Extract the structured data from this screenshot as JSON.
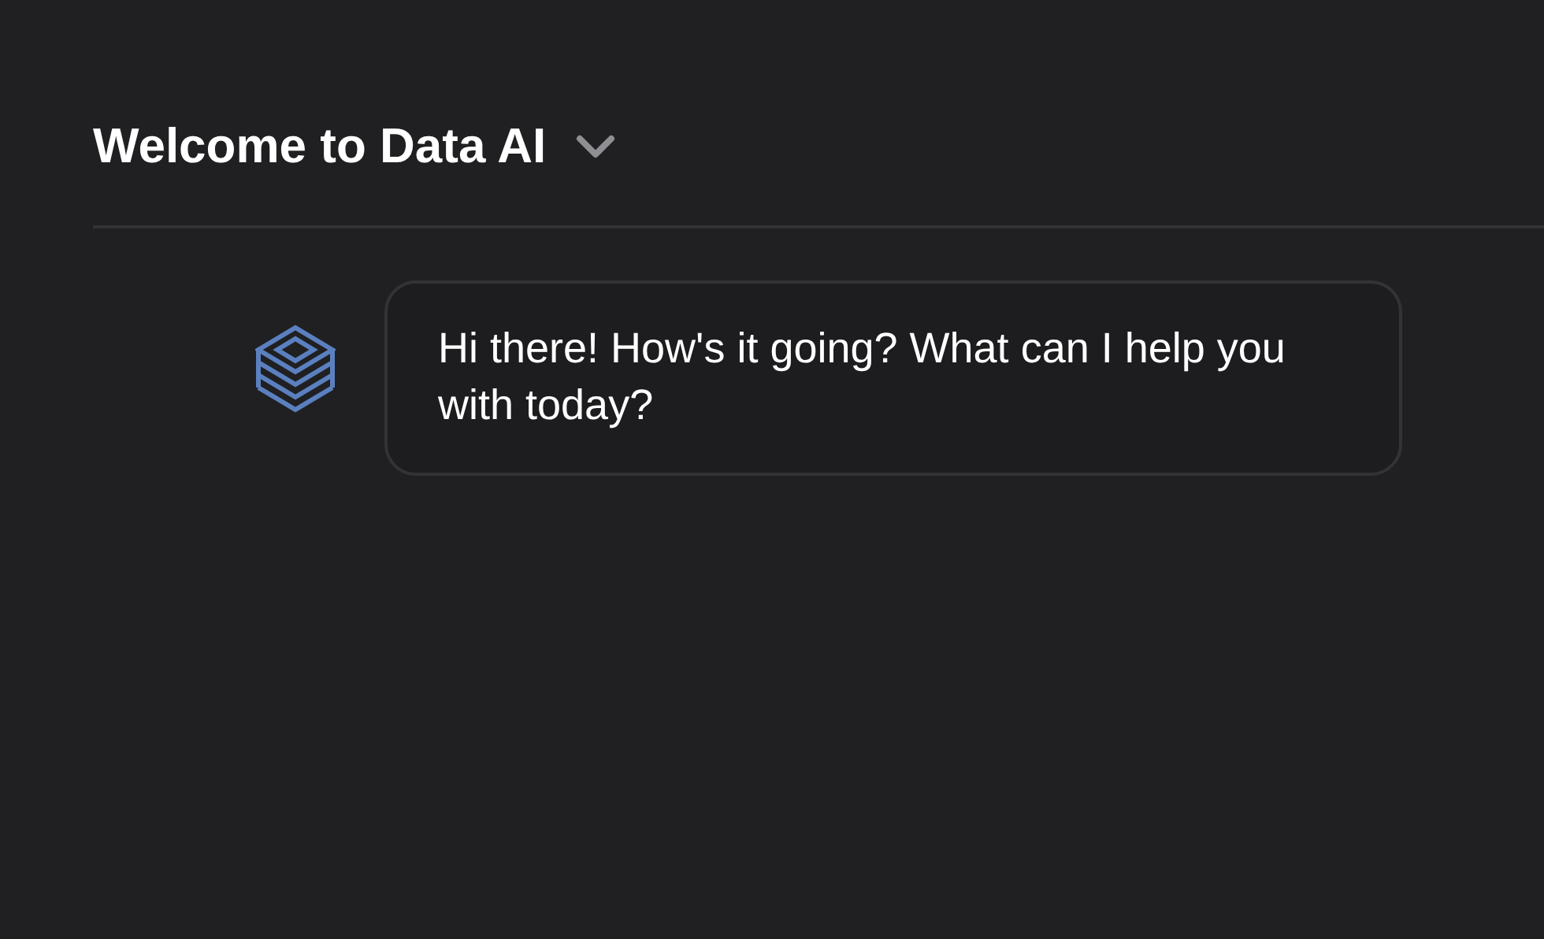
{
  "header": {
    "title": "Welcome to Data AI"
  },
  "messages": [
    {
      "kind": "assistant",
      "text": "Hi there! How's it going? What can I help you with today?"
    }
  ]
}
